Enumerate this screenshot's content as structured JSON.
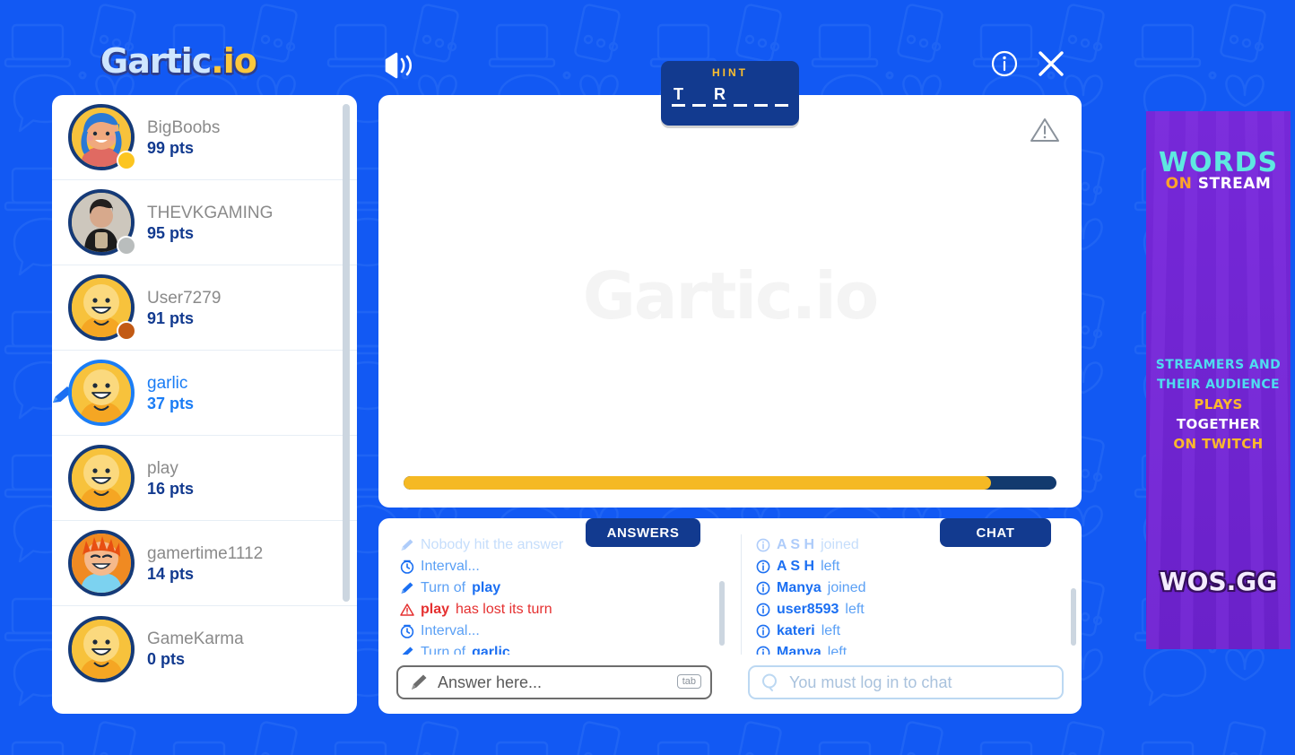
{
  "app": {
    "logo_primary": "Gartic",
    "logo_suffix": ".io",
    "canvas_watermark": "Gartic.io",
    "background_color": "#1259f3"
  },
  "header": {
    "sound_icon": "speaker-icon",
    "info_icon": "info-icon",
    "close_icon": "close-icon"
  },
  "hint": {
    "title": "HINT",
    "letters": [
      "T",
      "",
      "R",
      "",
      "",
      ""
    ],
    "length": 6
  },
  "players": {
    "scrollbar": "players-scrollbar",
    "list": [
      {
        "name": "BigBoobs",
        "points": "99 pts",
        "dot_color": "#fcc520",
        "drawing": false
      },
      {
        "name": "THEVKGAMING",
        "points": "95 pts",
        "dot_color": "#b9bdbd",
        "drawing": false
      },
      {
        "name": "User7279",
        "points": "91 pts",
        "dot_color": "#c25a14",
        "drawing": false
      },
      {
        "name": "garlic",
        "points": "37 pts",
        "dot_color": "",
        "drawing": true
      },
      {
        "name": "play",
        "points": "16 pts",
        "dot_color": "",
        "drawing": false
      },
      {
        "name": "gamertime1112",
        "points": "14 pts",
        "dot_color": "",
        "drawing": false
      },
      {
        "name": "GameKarma",
        "points": "0 pts",
        "dot_color": "",
        "drawing": false
      }
    ]
  },
  "canvas": {
    "report_icon": "warning-triangle-icon",
    "timer_percent": 90,
    "timer_fill_color": "#f5b924",
    "timer_track_color": "#123a6e"
  },
  "tabs": {
    "answers_label": "ANSWERS",
    "chat_label": "CHAT"
  },
  "answers_feed": [
    {
      "icon": "pencil-icon",
      "user": "",
      "text": "Nobody hit the answer",
      "style": "faded"
    },
    {
      "icon": "clock-icon",
      "user": "",
      "text": "Interval...",
      "style": "normal"
    },
    {
      "icon": "pencil-icon",
      "user": "play",
      "text": "Turn of",
      "style": "turn"
    },
    {
      "icon": "warning-icon",
      "user": "play",
      "text": "has lost its turn",
      "style": "alert"
    },
    {
      "icon": "clock-icon",
      "user": "",
      "text": "Interval...",
      "style": "normal"
    },
    {
      "icon": "pencil-icon",
      "user": "garlic",
      "text": "Turn of",
      "style": "turn"
    }
  ],
  "chat_feed": [
    {
      "icon": "info-icon",
      "user": "A S H",
      "text": "joined",
      "style": "faded"
    },
    {
      "icon": "info-icon",
      "user": "A S H",
      "text": "left",
      "style": "normal"
    },
    {
      "icon": "info-icon",
      "user": "Manya",
      "text": "joined",
      "style": "normal"
    },
    {
      "icon": "info-icon",
      "user": "user8593",
      "text": "left",
      "style": "normal"
    },
    {
      "icon": "info-icon",
      "user": "kateri",
      "text": "left",
      "style": "normal"
    },
    {
      "icon": "info-icon",
      "user": "Manya",
      "text": "left",
      "style": "normal"
    }
  ],
  "inputs": {
    "answer_placeholder": "Answer here...",
    "answer_value": "",
    "answer_tab_key": "tab",
    "answer_icon": "pencil-icon",
    "chat_placeholder": "You must log in to chat",
    "chat_value": "",
    "chat_icon": "search-icon"
  },
  "ad": {
    "title_words": "WORDS",
    "title_on": "ON",
    "title_stream": "STREAM",
    "line1": "STREAMERS AND",
    "line2": "THEIR AUDIENCE",
    "line3_a": "PLAYS",
    "line3_b": "TOGETHER",
    "line4": "ON TWITCH",
    "logo": "WOS.GG",
    "bg_color": "#7628d8"
  }
}
